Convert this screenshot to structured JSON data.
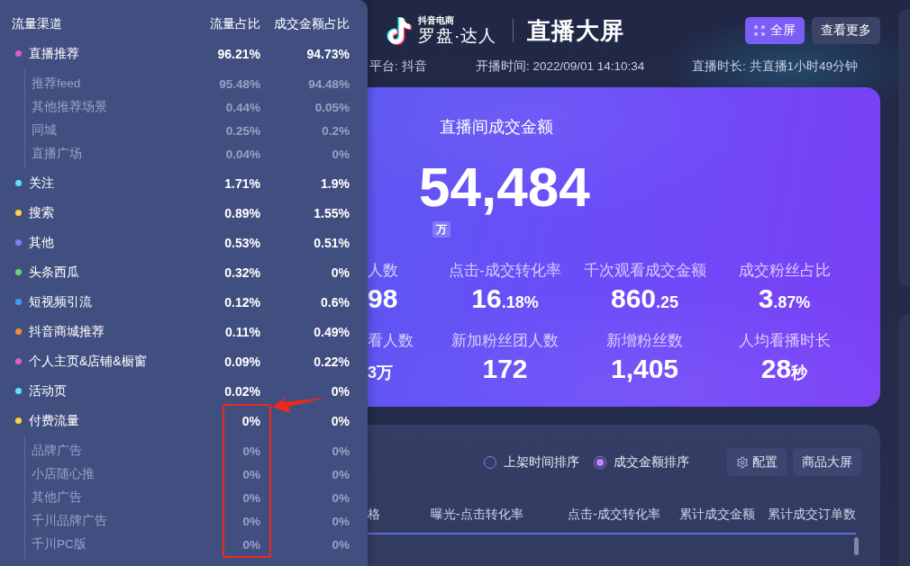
{
  "traffic_panel": {
    "columns": [
      "流量渠道",
      "流量占比",
      "成交金额占比"
    ],
    "rows": [
      {
        "name": "直播推荐",
        "traffic_share": "96.21%",
        "gmv_share": "94.73%",
        "color": "#e05ac9",
        "children": [
          {
            "name": "推荐feed",
            "traffic_share": "95.48%",
            "gmv_share": "94.48%"
          },
          {
            "name": "其他推荐场景",
            "traffic_share": "0.44%",
            "gmv_share": "0.05%"
          },
          {
            "name": "同城",
            "traffic_share": "0.25%",
            "gmv_share": "0.2%"
          },
          {
            "name": "直播广场",
            "traffic_share": "0.04%",
            "gmv_share": "0%"
          }
        ]
      },
      {
        "name": "关注",
        "traffic_share": "1.71%",
        "gmv_share": "1.9%",
        "color": "#5de3f7"
      },
      {
        "name": "搜索",
        "traffic_share": "0.89%",
        "gmv_share": "1.55%",
        "color": "#fdd338"
      },
      {
        "name": "其他",
        "traffic_share": "0.53%",
        "gmv_share": "0.51%",
        "color": "#7b80f6"
      },
      {
        "name": "头条西瓜",
        "traffic_share": "0.32%",
        "gmv_share": "0%",
        "color": "#62d86c"
      },
      {
        "name": "短视频引流",
        "traffic_share": "0.12%",
        "gmv_share": "0.6%",
        "color": "#3d9df6"
      },
      {
        "name": "抖音商城推荐",
        "traffic_share": "0.11%",
        "gmv_share": "0.49%",
        "color": "#f78b38"
      },
      {
        "name": "个人主页&店铺&橱窗",
        "traffic_share": "0.09%",
        "gmv_share": "0.22%",
        "color": "#e05ac9"
      },
      {
        "name": "活动页",
        "traffic_share": "0.02%",
        "gmv_share": "0%",
        "color": "#5de3f7"
      },
      {
        "name": "付费流量",
        "traffic_share": "0%",
        "gmv_share": "0%",
        "color": "#fdd338",
        "children": [
          {
            "name": "品牌广告",
            "traffic_share": "0%",
            "gmv_share": "0%"
          },
          {
            "name": "小店随心推",
            "traffic_share": "0%",
            "gmv_share": "0%"
          },
          {
            "name": "其他广告",
            "traffic_share": "0%",
            "gmv_share": "0%"
          },
          {
            "name": "千川品牌广告",
            "traffic_share": "0%",
            "gmv_share": "0%"
          },
          {
            "name": "千川PC版",
            "traffic_share": "0%",
            "gmv_share": "0%"
          }
        ]
      }
    ]
  },
  "header": {
    "logo_caption": "抖音电商",
    "logo_name": "罗盘·达人",
    "title": "直播大屏",
    "buttons": [
      {
        "label": "全屏",
        "kind": "fullscreen"
      },
      {
        "label": "查看更多",
        "kind": "more"
      }
    ]
  },
  "live_info": [
    "平台: 抖音",
    "开播时间: 2022/09/01 14:10:34",
    "直播时长: 共直播1小时49分钟"
  ],
  "gmv_card": {
    "title": "直播间成交金额",
    "value": "54,484",
    "unit": "万",
    "metrics": [
      {
        "label": "人数",
        "value": "98"
      },
      {
        "label": "点击-成交转化率",
        "value": "16",
        "minor": ".18%"
      },
      {
        "label": "千次观看成交金额",
        "value": "860",
        "minor": ".25"
      },
      {
        "label": "成交粉丝占比",
        "value": "3",
        "minor": ".87%"
      },
      {
        "label": "看人数",
        "minor": "3万"
      },
      {
        "label": "新加粉丝团人数",
        "value": "172"
      },
      {
        "label": "新增粉丝数",
        "value": "1,405"
      },
      {
        "label": "人均看播时长",
        "value": "28",
        "minor": "秒"
      }
    ]
  },
  "product_panel": {
    "sort_options": [
      {
        "label": "上架时间排序",
        "selected": false
      },
      {
        "label": "成交金额排序",
        "selected": true
      }
    ],
    "buttons": [
      {
        "label": "配置",
        "kind": "settings"
      },
      {
        "label": "商品大屏",
        "kind": "plain"
      }
    ],
    "table": {
      "columns": [
        "格",
        "曝光-点击转化率",
        "点击-成交转化率",
        "累计成交金额",
        "累计成交订单数"
      ]
    }
  }
}
